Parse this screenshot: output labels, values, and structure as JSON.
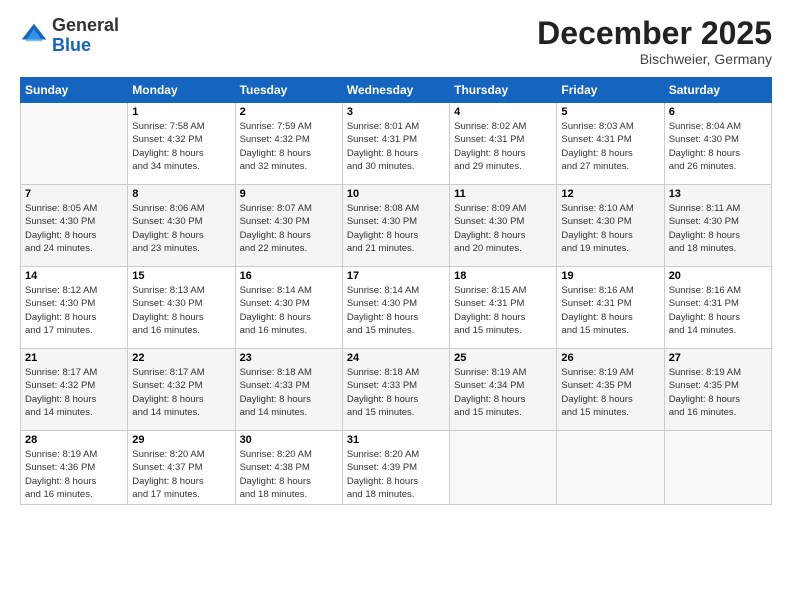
{
  "header": {
    "logo_line1": "General",
    "logo_line2": "Blue",
    "month": "December 2025",
    "location": "Bischweier, Germany"
  },
  "weekdays": [
    "Sunday",
    "Monday",
    "Tuesday",
    "Wednesday",
    "Thursday",
    "Friday",
    "Saturday"
  ],
  "weeks": [
    [
      {
        "day": "",
        "info": ""
      },
      {
        "day": "1",
        "info": "Sunrise: 7:58 AM\nSunset: 4:32 PM\nDaylight: 8 hours\nand 34 minutes."
      },
      {
        "day": "2",
        "info": "Sunrise: 7:59 AM\nSunset: 4:32 PM\nDaylight: 8 hours\nand 32 minutes."
      },
      {
        "day": "3",
        "info": "Sunrise: 8:01 AM\nSunset: 4:31 PM\nDaylight: 8 hours\nand 30 minutes."
      },
      {
        "day": "4",
        "info": "Sunrise: 8:02 AM\nSunset: 4:31 PM\nDaylight: 8 hours\nand 29 minutes."
      },
      {
        "day": "5",
        "info": "Sunrise: 8:03 AM\nSunset: 4:31 PM\nDaylight: 8 hours\nand 27 minutes."
      },
      {
        "day": "6",
        "info": "Sunrise: 8:04 AM\nSunset: 4:30 PM\nDaylight: 8 hours\nand 26 minutes."
      }
    ],
    [
      {
        "day": "7",
        "info": "Sunrise: 8:05 AM\nSunset: 4:30 PM\nDaylight: 8 hours\nand 24 minutes."
      },
      {
        "day": "8",
        "info": "Sunrise: 8:06 AM\nSunset: 4:30 PM\nDaylight: 8 hours\nand 23 minutes."
      },
      {
        "day": "9",
        "info": "Sunrise: 8:07 AM\nSunset: 4:30 PM\nDaylight: 8 hours\nand 22 minutes."
      },
      {
        "day": "10",
        "info": "Sunrise: 8:08 AM\nSunset: 4:30 PM\nDaylight: 8 hours\nand 21 minutes."
      },
      {
        "day": "11",
        "info": "Sunrise: 8:09 AM\nSunset: 4:30 PM\nDaylight: 8 hours\nand 20 minutes."
      },
      {
        "day": "12",
        "info": "Sunrise: 8:10 AM\nSunset: 4:30 PM\nDaylight: 8 hours\nand 19 minutes."
      },
      {
        "day": "13",
        "info": "Sunrise: 8:11 AM\nSunset: 4:30 PM\nDaylight: 8 hours\nand 18 minutes."
      }
    ],
    [
      {
        "day": "14",
        "info": "Sunrise: 8:12 AM\nSunset: 4:30 PM\nDaylight: 8 hours\nand 17 minutes."
      },
      {
        "day": "15",
        "info": "Sunrise: 8:13 AM\nSunset: 4:30 PM\nDaylight: 8 hours\nand 16 minutes."
      },
      {
        "day": "16",
        "info": "Sunrise: 8:14 AM\nSunset: 4:30 PM\nDaylight: 8 hours\nand 16 minutes."
      },
      {
        "day": "17",
        "info": "Sunrise: 8:14 AM\nSunset: 4:30 PM\nDaylight: 8 hours\nand 15 minutes."
      },
      {
        "day": "18",
        "info": "Sunrise: 8:15 AM\nSunset: 4:31 PM\nDaylight: 8 hours\nand 15 minutes."
      },
      {
        "day": "19",
        "info": "Sunrise: 8:16 AM\nSunset: 4:31 PM\nDaylight: 8 hours\nand 15 minutes."
      },
      {
        "day": "20",
        "info": "Sunrise: 8:16 AM\nSunset: 4:31 PM\nDaylight: 8 hours\nand 14 minutes."
      }
    ],
    [
      {
        "day": "21",
        "info": "Sunrise: 8:17 AM\nSunset: 4:32 PM\nDaylight: 8 hours\nand 14 minutes."
      },
      {
        "day": "22",
        "info": "Sunrise: 8:17 AM\nSunset: 4:32 PM\nDaylight: 8 hours\nand 14 minutes."
      },
      {
        "day": "23",
        "info": "Sunrise: 8:18 AM\nSunset: 4:33 PM\nDaylight: 8 hours\nand 14 minutes."
      },
      {
        "day": "24",
        "info": "Sunrise: 8:18 AM\nSunset: 4:33 PM\nDaylight: 8 hours\nand 15 minutes."
      },
      {
        "day": "25",
        "info": "Sunrise: 8:19 AM\nSunset: 4:34 PM\nDaylight: 8 hours\nand 15 minutes."
      },
      {
        "day": "26",
        "info": "Sunrise: 8:19 AM\nSunset: 4:35 PM\nDaylight: 8 hours\nand 15 minutes."
      },
      {
        "day": "27",
        "info": "Sunrise: 8:19 AM\nSunset: 4:35 PM\nDaylight: 8 hours\nand 16 minutes."
      }
    ],
    [
      {
        "day": "28",
        "info": "Sunrise: 8:19 AM\nSunset: 4:36 PM\nDaylight: 8 hours\nand 16 minutes."
      },
      {
        "day": "29",
        "info": "Sunrise: 8:20 AM\nSunset: 4:37 PM\nDaylight: 8 hours\nand 17 minutes."
      },
      {
        "day": "30",
        "info": "Sunrise: 8:20 AM\nSunset: 4:38 PM\nDaylight: 8 hours\nand 18 minutes."
      },
      {
        "day": "31",
        "info": "Sunrise: 8:20 AM\nSunset: 4:39 PM\nDaylight: 8 hours\nand 18 minutes."
      },
      {
        "day": "",
        "info": ""
      },
      {
        "day": "",
        "info": ""
      },
      {
        "day": "",
        "info": ""
      }
    ]
  ]
}
